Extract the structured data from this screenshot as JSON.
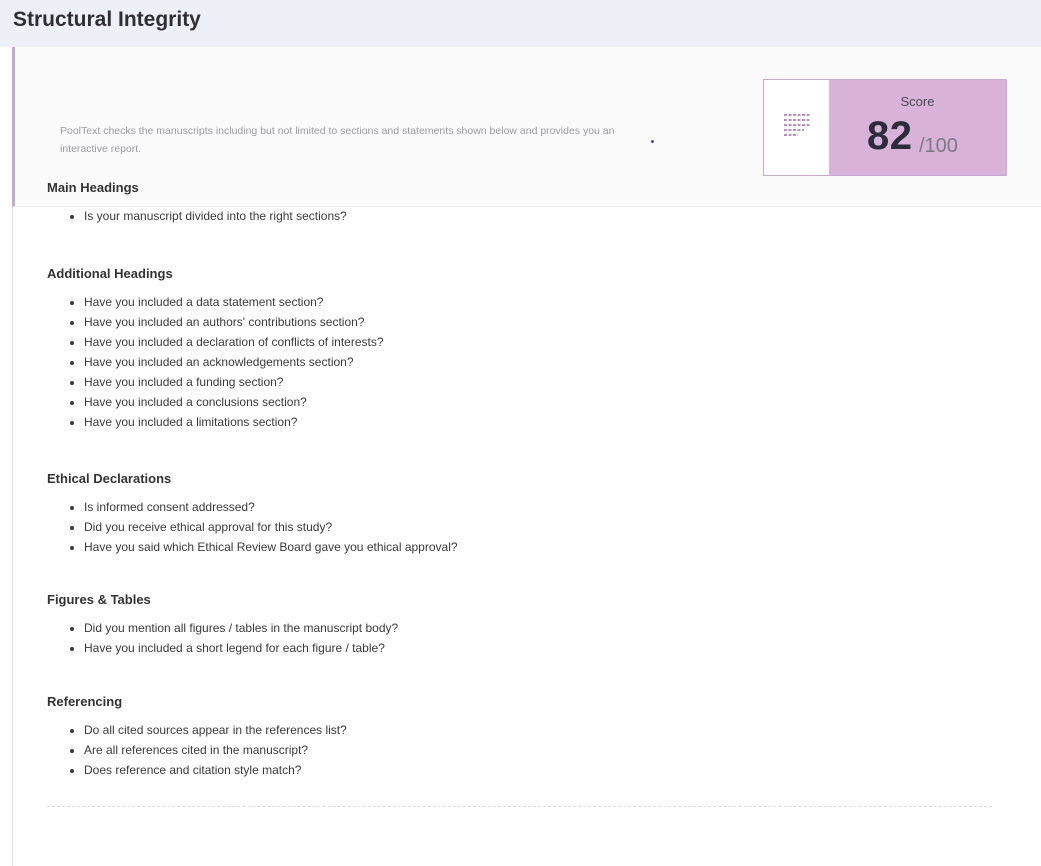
{
  "header": {
    "title": "Structural Integrity"
  },
  "intro": {
    "description": "PoolText checks the manuscripts including but not limited to sections and statements shown below and provides you an interactive report."
  },
  "score": {
    "label": "Score",
    "value": "82",
    "total": "/100",
    "icon": "document-lines-icon",
    "accent_color": "#d8b2d9",
    "icon_color": "#b07fbd"
  },
  "sections": [
    {
      "heading": "Main Headings",
      "items": [
        "Is your manuscript divided into the right sections?"
      ]
    },
    {
      "heading": "Additional Headings",
      "items": [
        "Have you included a data statement section?",
        "Have you included an authors' contributions section?",
        "Have you included a declaration of conflicts of interests?",
        "Have you included an acknowledgements section?",
        "Have you included a funding section?",
        "Have you included a conclusions section?",
        "Have you included a limitations section?"
      ]
    },
    {
      "heading": "Ethical Declarations",
      "items": [
        "Is informed consent addressed?",
        "Did you receive ethical approval for this study?",
        "Have you said which Ethical Review Board gave you ethical approval?"
      ]
    },
    {
      "heading": "Figures & Tables",
      "items": [
        "Did you mention all figures / tables in the manuscript body?",
        "Have you included a short legend for each figure / table?"
      ]
    },
    {
      "heading": "Referencing",
      "items": [
        "Do all cited sources appear in the references list?",
        "Are all references cited in the manuscript?",
        "Does reference and citation style match?"
      ]
    }
  ]
}
